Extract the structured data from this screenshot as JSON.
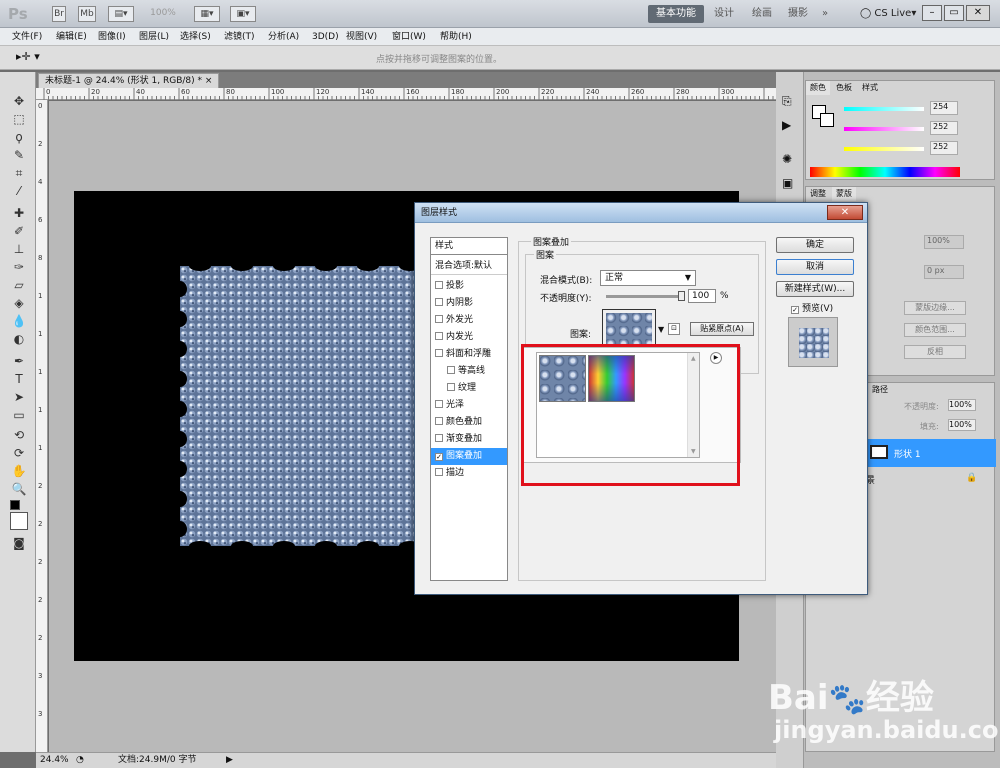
{
  "app": {
    "logo": "Ps",
    "zoom_box": "100%",
    "workspaces": [
      "基本功能",
      "设计",
      "绘画",
      "摄影",
      "»"
    ],
    "cslive": "CS Live"
  },
  "menu": [
    "文件(F)",
    "编辑(E)",
    "图像(I)",
    "图层(L)",
    "选择(S)",
    "滤镜(T)",
    "分析(A)",
    "3D(D)",
    "视图(V)",
    "窗口(W)",
    "帮助(H)"
  ],
  "options": {
    "hint": "点按并拖移可调整图案的位置。"
  },
  "document": {
    "tab_title": "未标题-1 @ 24.4% (形状 1, RGB/8) *",
    "close": "×"
  },
  "ruler_h": [
    "0",
    "20",
    "40",
    "60",
    "80",
    "100",
    "120",
    "140",
    "160",
    "180",
    "200",
    "220",
    "240",
    "260",
    "280",
    "300"
  ],
  "ruler_v": [
    "0",
    "2",
    "4",
    "6",
    "8",
    "1",
    "1",
    "1",
    "1",
    "1",
    "2",
    "2",
    "2",
    "2",
    "2",
    "3",
    "3"
  ],
  "status": {
    "zoom": "24.4%",
    "doc": "文档:24.9M/0 字节"
  },
  "color_panel": {
    "tabs": [
      "颜色",
      "色板",
      "样式"
    ],
    "values": [
      "254",
      "252",
      "252"
    ],
    "slider_labels": [
      "R",
      "G",
      "B"
    ]
  },
  "adjust_panel": {
    "tabs": [
      "调整",
      "蒙版"
    ],
    "density": "100%",
    "feather": "0 px",
    "buttons": [
      "蒙版边缘...",
      "颜色范围...",
      "反相"
    ]
  },
  "layers_panel": {
    "tab": "路径",
    "opacity_label": "不透明度:",
    "opacity": "100%",
    "fill_label": "填充:",
    "fill": "100%",
    "layer_name": "形状 1",
    "bg_name": "景"
  },
  "dialog": {
    "title": "图层样式",
    "close": "✕",
    "styles_header": "样式",
    "blend_options": "混合选项:默认",
    "effects": [
      {
        "label": "投影",
        "checked": false
      },
      {
        "label": "内阴影",
        "checked": false
      },
      {
        "label": "外发光",
        "checked": false
      },
      {
        "label": "内发光",
        "checked": false
      },
      {
        "label": "斜面和浮雕",
        "checked": false
      },
      {
        "label": "等高线",
        "checked": false
      },
      {
        "label": "纹理",
        "checked": false
      },
      {
        "label": "光泽",
        "checked": false
      },
      {
        "label": "颜色叠加",
        "checked": false
      },
      {
        "label": "渐变叠加",
        "checked": false
      },
      {
        "label": "图案叠加",
        "checked": true
      },
      {
        "label": "描边",
        "checked": false
      }
    ],
    "section_title": "图案叠加",
    "subsection": "图案",
    "blend_mode_label": "混合模式(B):",
    "blend_mode": "正常",
    "opacity_label": "不透明度(Y):",
    "opacity_value": "100",
    "opacity_unit": "%",
    "pattern_label": "图案:",
    "snap_button": "贴紧原点(A)",
    "ok": "确定",
    "cancel": "取消",
    "new_style": "新建样式(W)...",
    "preview_label": "预览(V)",
    "preview_checked": true
  },
  "watermark": {
    "brand": "Bai",
    "brand2": "经验",
    "url": "jingyan.baidu.com"
  }
}
